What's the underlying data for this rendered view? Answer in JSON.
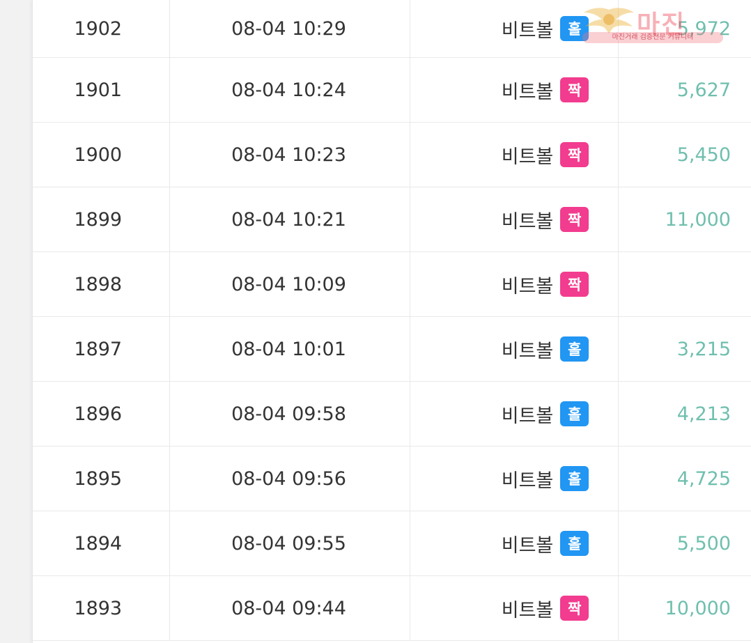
{
  "watermark": {
    "title": "마진",
    "subtitle": "마진거래 검증전문 커뮤니티"
  },
  "colors": {
    "odd_badge": "#2196f3",
    "even_badge": "#f23c8f",
    "amount_text": "#6fbfae"
  },
  "rows": [
    {
      "round": "1902",
      "time": "08-04 10:29",
      "game": "비트볼",
      "pick": "홀",
      "pick_type": "odd",
      "amount": "5,972"
    },
    {
      "round": "1901",
      "time": "08-04 10:24",
      "game": "비트볼",
      "pick": "짝",
      "pick_type": "even",
      "amount": "5,627"
    },
    {
      "round": "1900",
      "time": "08-04 10:23",
      "game": "비트볼",
      "pick": "짝",
      "pick_type": "even",
      "amount": "5,450"
    },
    {
      "round": "1899",
      "time": "08-04 10:21",
      "game": "비트볼",
      "pick": "짝",
      "pick_type": "even",
      "amount": "11,000"
    },
    {
      "round": "1898",
      "time": "08-04 10:09",
      "game": "비트볼",
      "pick": "짝",
      "pick_type": "even",
      "amount": ""
    },
    {
      "round": "1897",
      "time": "08-04 10:01",
      "game": "비트볼",
      "pick": "홀",
      "pick_type": "odd",
      "amount": "3,215"
    },
    {
      "round": "1896",
      "time": "08-04 09:58",
      "game": "비트볼",
      "pick": "홀",
      "pick_type": "odd",
      "amount": "4,213"
    },
    {
      "round": "1895",
      "time": "08-04 09:56",
      "game": "비트볼",
      "pick": "홀",
      "pick_type": "odd",
      "amount": "4,725"
    },
    {
      "round": "1894",
      "time": "08-04 09:55",
      "game": "비트볼",
      "pick": "홀",
      "pick_type": "odd",
      "amount": "5,500"
    },
    {
      "round": "1893",
      "time": "08-04 09:44",
      "game": "비트볼",
      "pick": "짝",
      "pick_type": "even",
      "amount": "10,000"
    }
  ]
}
